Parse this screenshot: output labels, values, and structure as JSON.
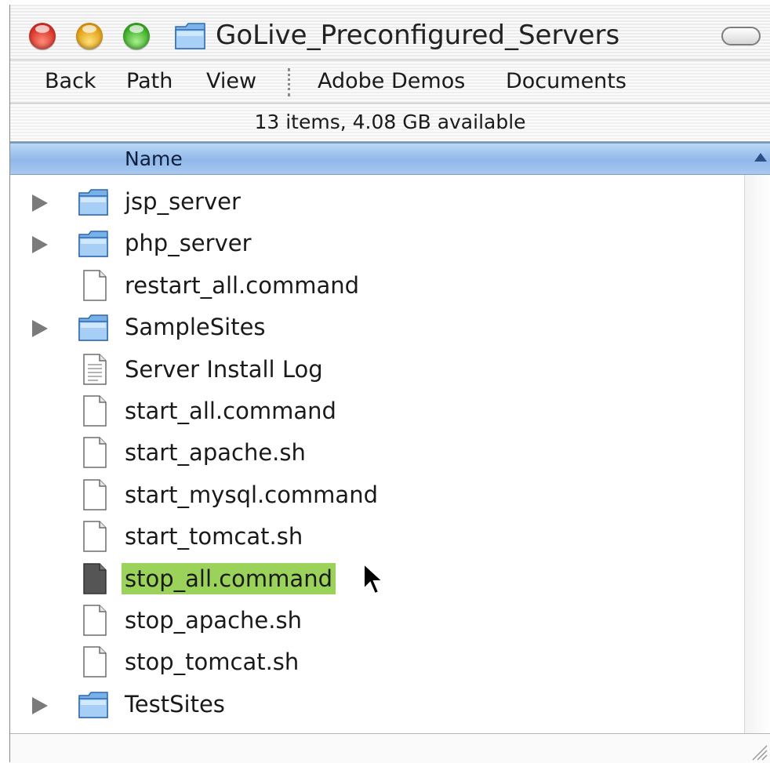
{
  "window": {
    "title": "GoLive_Preconfigured_Servers",
    "title_icon": "folder-icon"
  },
  "toolbar": {
    "items": [
      "Back",
      "Path",
      "View",
      "Adobe Demos",
      "Documents"
    ]
  },
  "status": {
    "text": "13 items, 4.08 GB available"
  },
  "columns": {
    "name": "Name",
    "sort": "ascending"
  },
  "files": [
    {
      "name": "jsp_server",
      "kind": "folder",
      "expandable": true
    },
    {
      "name": "php_server",
      "kind": "folder",
      "expandable": true
    },
    {
      "name": "restart_all.command",
      "kind": "document"
    },
    {
      "name": "SampleSites",
      "kind": "folder",
      "expandable": true
    },
    {
      "name": "Server Install Log",
      "kind": "text-document"
    },
    {
      "name": "start_all.command",
      "kind": "document"
    },
    {
      "name": "start_apache.sh",
      "kind": "document"
    },
    {
      "name": "start_mysql.command",
      "kind": "document"
    },
    {
      "name": "start_tomcat.sh",
      "kind": "document"
    },
    {
      "name": "stop_all.command",
      "kind": "document-dark",
      "selected": true
    },
    {
      "name": "stop_apache.sh",
      "kind": "document"
    },
    {
      "name": "stop_tomcat.sh",
      "kind": "document"
    },
    {
      "name": "TestSites",
      "kind": "folder",
      "expandable": true
    }
  ],
  "colors": {
    "header_blue": "#8fb8ea",
    "selection_green": "#9bd35a"
  }
}
